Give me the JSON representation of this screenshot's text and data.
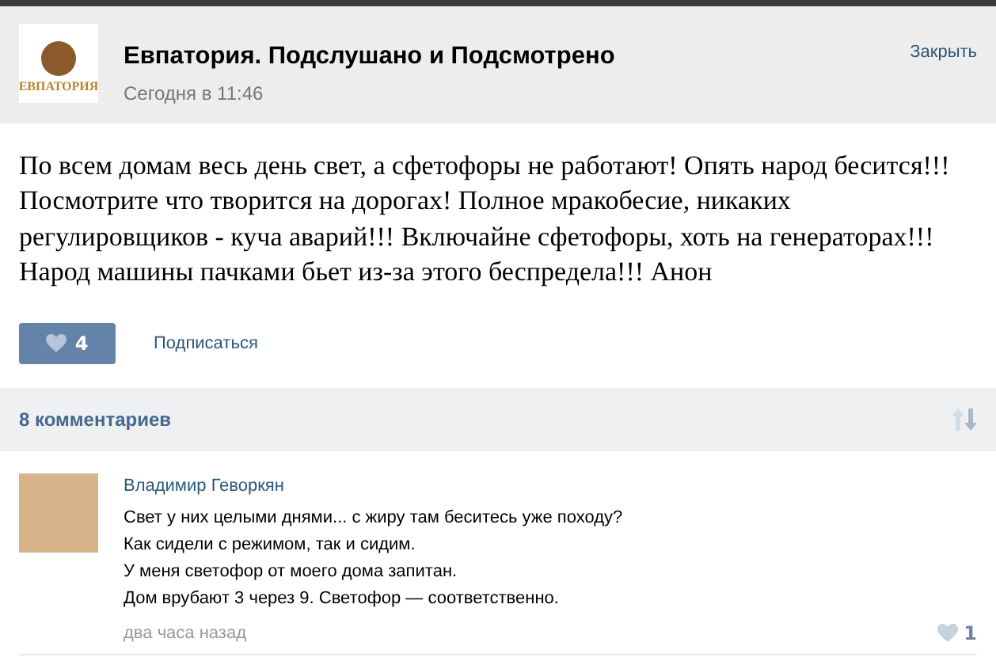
{
  "header": {
    "logo_text": "ЕВПАТОРИЯ",
    "title": "Евпатория. Подслушано и Подсмотрено",
    "time": "Сегодня в 11:46",
    "close": "Закрыть"
  },
  "post": {
    "text": "По всем домам весь день свет, а сфетофоры не работают! Опять народ бесится!!! Посмотрите что творится на дорогах! Полное мракобесие, никаких регулировщиков - куча аварий!!! Включайне сфетофоры, хоть на генераторах!!! Народ машины пачками бьет из-за этого беспредела!!! Анон",
    "likes": "4",
    "liked": true,
    "subscribe": "Подписаться"
  },
  "comments_bar": {
    "count": "8 комментариев"
  },
  "comments": [
    {
      "author": "Владимир Геворкян",
      "lines": [
        "Свет у них целыми днями... с жиру там беситесь уже походу?",
        "Как сидели с режимом, так и сидим.",
        "У меня светофор от моего дома запитан.",
        "Дом врубают 3 через 9. Светофор — соответственно."
      ],
      "time": "два часа назад",
      "likes": "1"
    }
  ]
}
